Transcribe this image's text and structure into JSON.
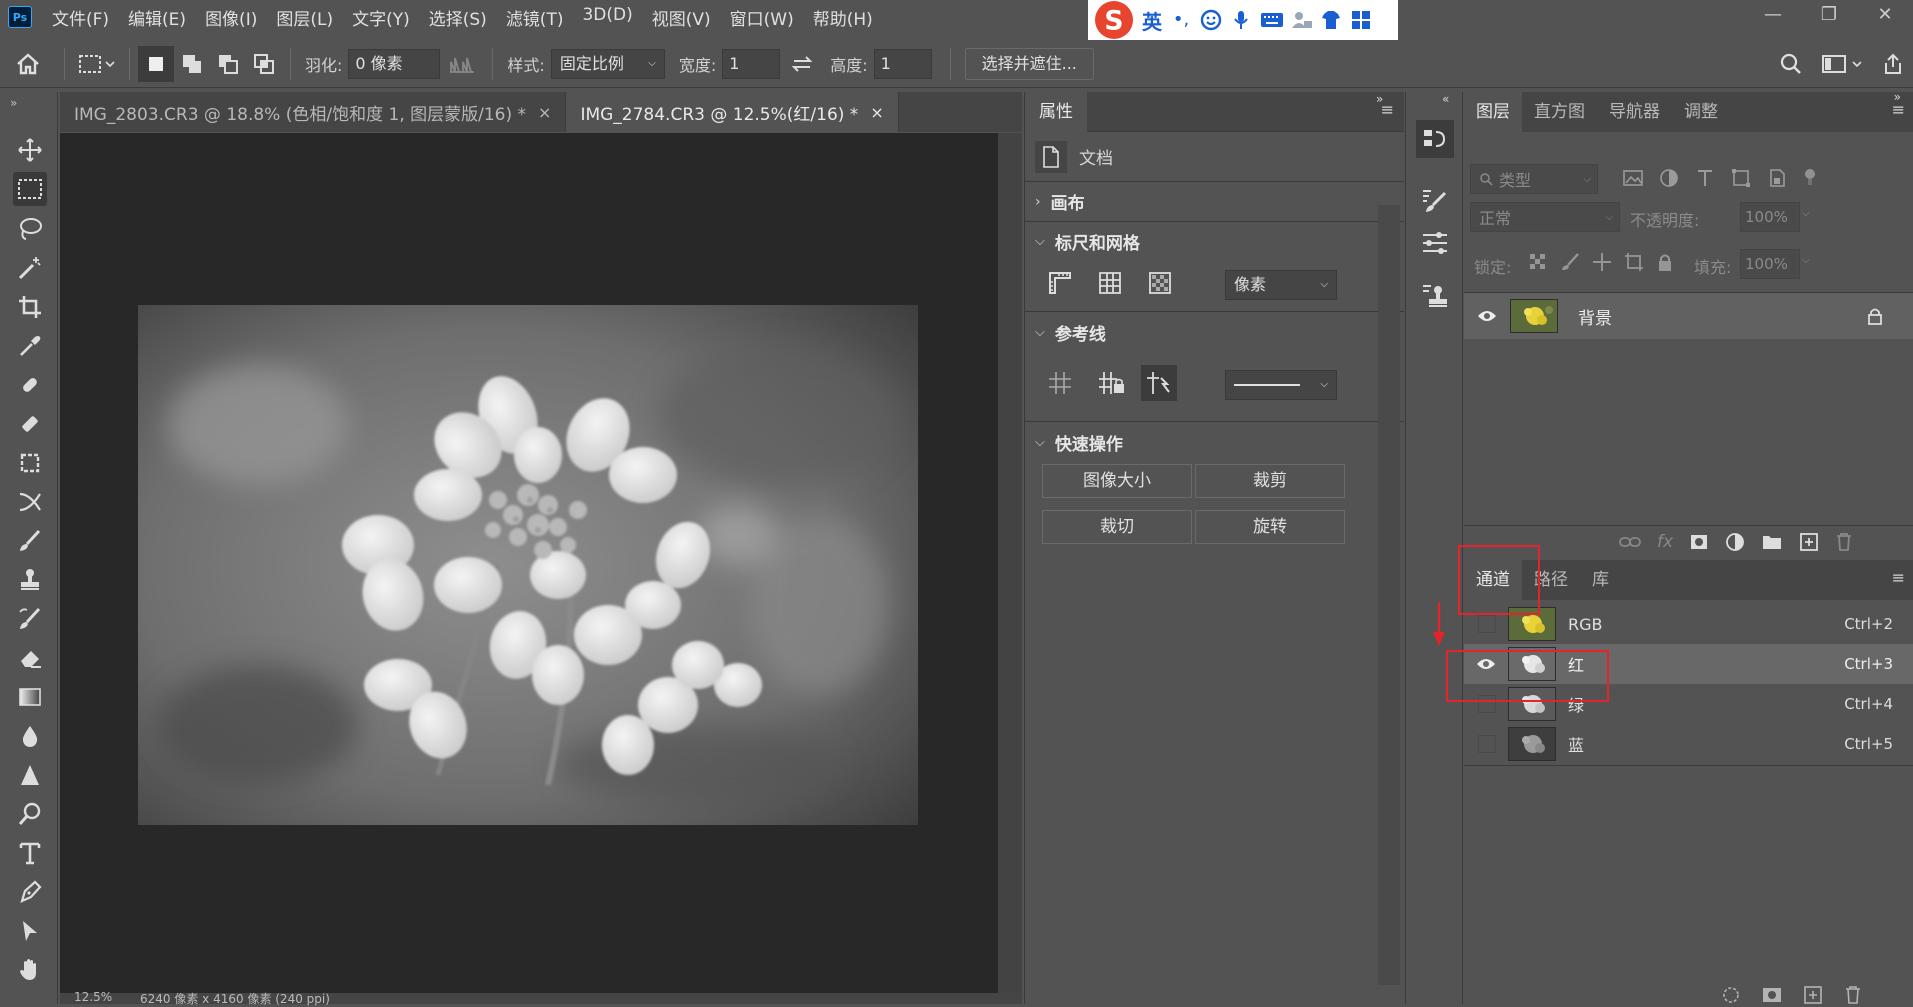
{
  "app": {
    "logo": "Ps"
  },
  "menu": [
    "文件(F)",
    "编辑(E)",
    "图像(I)",
    "图层(L)",
    "文字(Y)",
    "选择(S)",
    "滤镜(T)",
    "3D(D)",
    "视图(V)",
    "窗口(W)",
    "帮助(H)"
  ],
  "window_controls": {
    "minimize": "—",
    "restore": "❐",
    "close": "✕"
  },
  "ime": {
    "logo": "S",
    "mode": "英",
    "punct": "•,"
  },
  "options": {
    "feather_label": "羽化:",
    "feather_value": "0 像素",
    "style_label": "样式:",
    "style_value": "固定比例",
    "width_label": "宽度:",
    "width_value": "1",
    "height_label": "高度:",
    "height_value": "1",
    "select_mask_button": "选择并遮住..."
  },
  "tabs": [
    {
      "label": "IMG_2803.CR3 @ 18.8% (色相/饱和度 1, 图层蒙版/16) *",
      "close": "×",
      "active": false
    },
    {
      "label": "IMG_2784.CR3 @ 12.5%(红/16) *",
      "close": "×",
      "active": true
    }
  ],
  "status": {
    "zoom": "12.5%",
    "dims": "6240 像素 x 4160 像素 (240 ppi)"
  },
  "properties": {
    "title": "属性",
    "doc_label": "文档",
    "sec_canvas": "画布",
    "sec_rulers": "标尺和网格",
    "units_value": "像素",
    "sec_guides": "参考线",
    "sec_quick": "快速操作",
    "btn_image_size": "图像大小",
    "btn_crop": "裁剪",
    "btn_trim": "裁切",
    "btn_rotate": "旋转"
  },
  "layers_panel": {
    "tabs": [
      "图层",
      "直方图",
      "导航器",
      "调整"
    ],
    "filter_placeholder": "类型",
    "blend_mode": "正常",
    "opacity_label": "不透明度:",
    "opacity_value": "100%",
    "lock_label": "锁定:",
    "fill_label": "填充:",
    "fill_value": "100%",
    "layers": [
      {
        "name": "背景",
        "visible": true,
        "locked": true
      }
    ]
  },
  "channels_panel": {
    "tabs": [
      "通道",
      "路径",
      "库"
    ],
    "channels": [
      {
        "name": "RGB",
        "shortcut": "Ctrl+2",
        "visible": false,
        "selected": false
      },
      {
        "name": "红",
        "shortcut": "Ctrl+3",
        "visible": true,
        "selected": true
      },
      {
        "name": "绿",
        "shortcut": "Ctrl+4",
        "visible": false,
        "selected": false
      },
      {
        "name": "蓝",
        "shortcut": "Ctrl+5",
        "visible": false,
        "selected": false
      }
    ]
  },
  "colors": {
    "accent_annotation": "#e3242b",
    "panel_bg": "#535353",
    "canvas_bg": "#282828"
  }
}
